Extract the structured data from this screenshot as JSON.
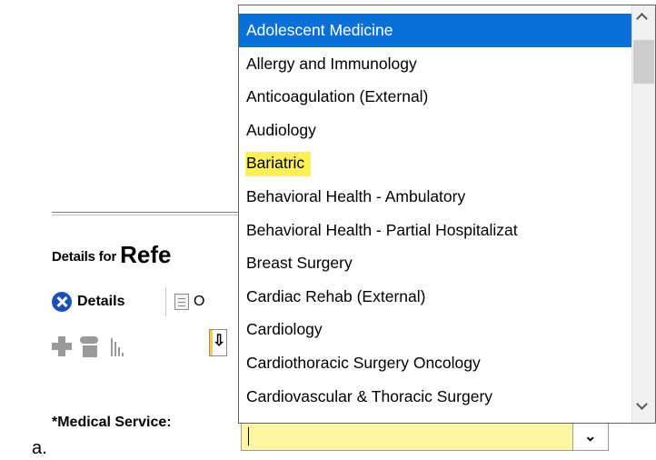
{
  "annotation_marker": "a.",
  "form": {
    "details_for_prefix": "Details for",
    "details_for_title": "Refe",
    "tabs": [
      {
        "label": "Details",
        "icon": "close-circle-icon"
      },
      {
        "label": "O",
        "icon": "document-icon"
      }
    ],
    "toolbar_icons": [
      "plus-icon",
      "phone-icon",
      "bars-icon",
      "down-arrow-icon"
    ],
    "toolbar_arrow_glyph": "⇩",
    "medical_service_label": "*Medical Service:",
    "medical_service_value": "",
    "field_highlight_color": "#fff6a3"
  },
  "dropdown": {
    "items": [
      "Adolescent Medicine",
      "Allergy and Immunology",
      "Anticoagulation (External)",
      "Audiology",
      "Bariatric",
      "Behavioral Health - Ambulatory",
      "Behavioral Health - Partial Hospitalizat",
      "Breast Surgery",
      "Cardiac Rehab (External)",
      "Cardiology",
      "Cardiothoracic Surgery Oncology",
      "Cardiovascular & Thoracic Surgery"
    ],
    "selected_index": 0,
    "highlighted_index": 4,
    "selected_color": "#0a6fd6",
    "highlight_color": "#fbf05a",
    "combo_arrow_glyph": "⌄"
  }
}
